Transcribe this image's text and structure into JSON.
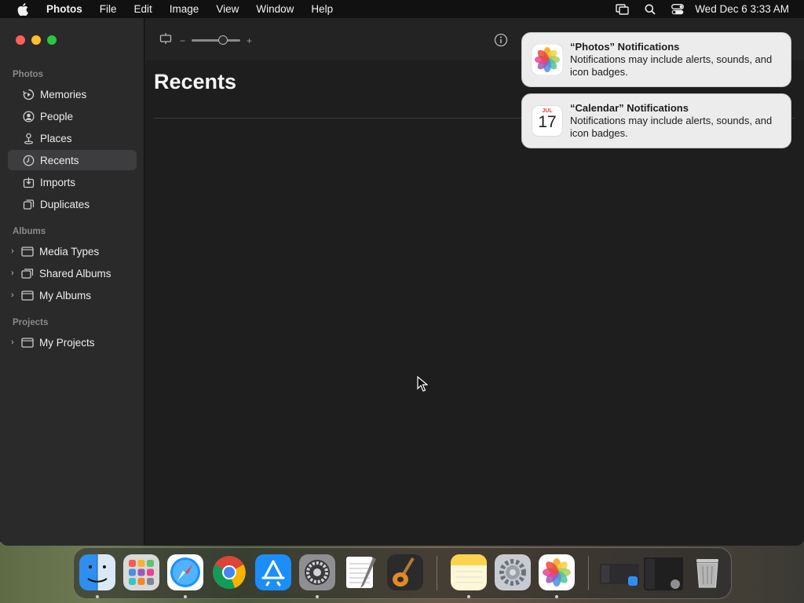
{
  "menubar": {
    "app_name": "Photos",
    "items": [
      "File",
      "Edit",
      "Image",
      "View",
      "Window",
      "Help"
    ],
    "clock": "Wed Dec 6  3:33 AM",
    "status_icons": [
      "screen-mirroring-icon",
      "search-icon",
      "control-center-icon"
    ]
  },
  "sidebar": {
    "sections": {
      "photos": "Photos",
      "albums": "Albums",
      "projects": "Projects"
    },
    "photos_items": [
      {
        "label": "Memories",
        "icon": "memories-icon"
      },
      {
        "label": "People",
        "icon": "people-icon"
      },
      {
        "label": "Places",
        "icon": "places-icon"
      },
      {
        "label": "Recents",
        "icon": "recents-icon",
        "selected": true
      },
      {
        "label": "Imports",
        "icon": "imports-icon"
      },
      {
        "label": "Duplicates",
        "icon": "duplicates-icon"
      }
    ],
    "album_items": [
      {
        "label": "Media Types",
        "icon": "folder-icon"
      },
      {
        "label": "Shared Albums",
        "icon": "shared-albums-icon"
      },
      {
        "label": "My Albums",
        "icon": "folder-icon"
      }
    ],
    "project_items": [
      {
        "label": "My Projects",
        "icon": "folder-icon"
      }
    ]
  },
  "main": {
    "title": "Recents",
    "zoom_minus": "−",
    "zoom_plus": "+",
    "zoom_level": 0.6
  },
  "notifications": [
    {
      "title": "“Photos” Notifications",
      "body": "Notifications may include alerts, sounds, and icon badges.",
      "icon": "photos-app-icon"
    },
    {
      "title": "“Calendar” Notifications",
      "body": "Notifications may include alerts, sounds, and icon badges.",
      "icon": "calendar-app-icon",
      "cal_month": "JUL",
      "cal_day": "17"
    }
  ],
  "dock": {
    "apps": [
      "Finder",
      "Launchpad",
      "Safari",
      "Chrome",
      "App Store",
      "System Settings",
      "TextEdit",
      "GarageBand",
      "Notes",
      "System Preferences",
      "Photos"
    ],
    "running": [
      "Finder",
      "Safari",
      "System Settings",
      "Notes",
      "Photos"
    ]
  },
  "colors": {
    "accent_red": "#fe5f57",
    "accent_yellow": "#febc2e",
    "accent_green": "#28c840",
    "sidebar_bg": "#2a2a2b",
    "selected_bg": "#3d3d3f"
  }
}
